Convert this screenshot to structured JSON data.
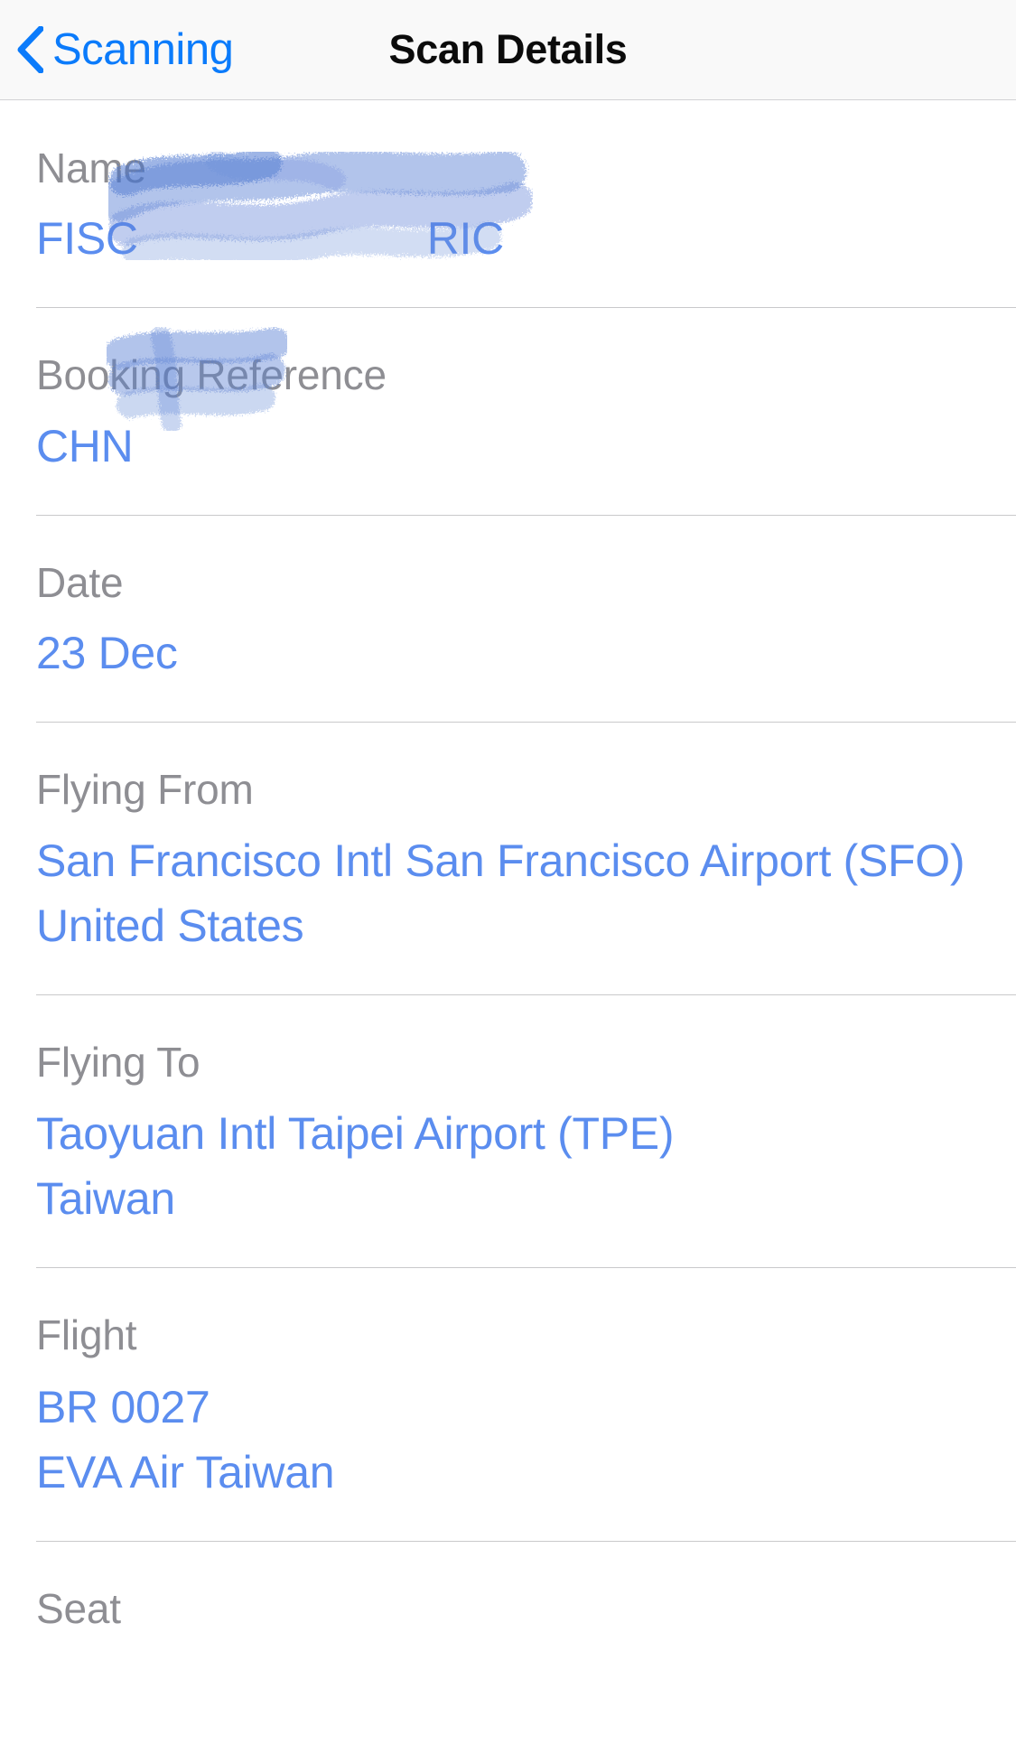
{
  "navbar": {
    "back_label": "Scanning",
    "back_icon": "chevron-left-icon",
    "title": "Scan Details"
  },
  "colors": {
    "accent_blue": "#0b7bfb",
    "value_blue": "#5b8def",
    "label_gray": "#8e8e93",
    "title_black": "#0b0b0b",
    "divider": "#c9c9cb",
    "navbar_bg": "#f9f9f9",
    "redaction_blue": "#5a7fd4"
  },
  "details": {
    "name": {
      "label": "Name",
      "value_visible_start": "FISC",
      "value_visible_end": "RIC",
      "redacted": true
    },
    "booking_reference": {
      "label": "Booking Reference",
      "value_visible_start": "CHN",
      "redacted": true
    },
    "date": {
      "label": "Date",
      "value": "23 Dec"
    },
    "flying_from": {
      "label": "Flying From",
      "value_lines": [
        "San Francisco Intl San Francisco Airport (SFO)",
        "United States"
      ]
    },
    "flying_to": {
      "label": "Flying To",
      "value_lines": [
        "Taoyuan Intl Taipei Airport (TPE)",
        "Taiwan"
      ]
    },
    "flight": {
      "label": "Flight",
      "value_lines": [
        "BR 0027",
        "EVA Air Taiwan"
      ]
    },
    "seat": {
      "label": "Seat"
    }
  }
}
